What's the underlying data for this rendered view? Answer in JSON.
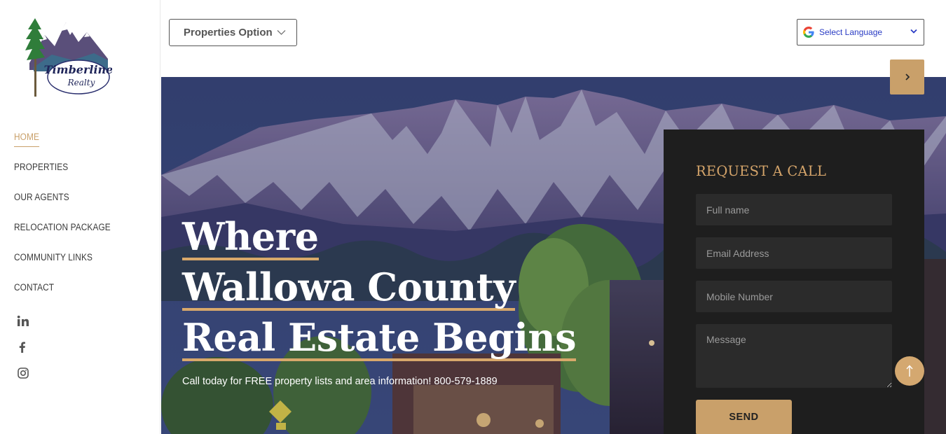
{
  "brand": {
    "logo_line1": "Timberline",
    "logo_line2": "Realty"
  },
  "nav": [
    {
      "label": "HOME",
      "active": true
    },
    {
      "label": "PROPERTIES"
    },
    {
      "label": "OUR AGENTS"
    },
    {
      "label": "RELOCATION PACKAGE"
    },
    {
      "label": "COMMUNITY LINKS"
    },
    {
      "label": "CONTACT"
    }
  ],
  "social": [
    "linkedin-icon",
    "facebook-icon",
    "instagram-icon"
  ],
  "topbar": {
    "properties_label": "Properties Option",
    "language_label": "Select Language"
  },
  "hero": {
    "headline": [
      "Where",
      "Wallowa County",
      "Real Estate Begins"
    ],
    "tagline": "Call today for FREE property lists and area information! 800-579-1889"
  },
  "request": {
    "title": "REQUEST A CALL",
    "name_placeholder": "Full name",
    "email_placeholder": "Email Address",
    "mobile_placeholder": "Mobile Number",
    "message_placeholder": "Message",
    "send_label": "SEND"
  },
  "colors": {
    "accent": "#c9a06a",
    "panel": "#1e1e1e",
    "field": "#2b2b2b",
    "link": "#2a3cc4"
  }
}
